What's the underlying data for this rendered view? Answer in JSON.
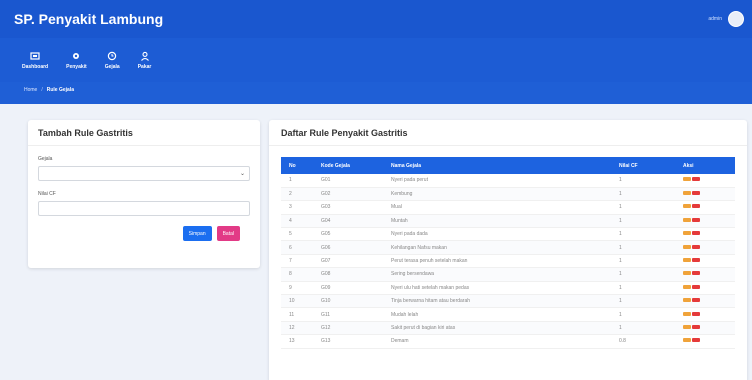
{
  "app": {
    "title": "SP. Penyakit Lambung",
    "user": "admin"
  },
  "nav": [
    {
      "label": "Dashboard",
      "icon": "dashboard-icon"
    },
    {
      "label": "Penyakit",
      "icon": "virus-icon"
    },
    {
      "label": "Gejala",
      "icon": "clock-icon"
    },
    {
      "label": "Pakar",
      "icon": "user-icon"
    }
  ],
  "breadcrumb": {
    "home": "Home",
    "current": "Rule Gejala"
  },
  "form": {
    "title": "Tambah Rule Gastritis",
    "gejala_label": "Gejala",
    "gejala_value": "",
    "nilai_label": "Nilai CF",
    "nilai_value": "",
    "simpan": "Simpan",
    "batal": "Batal"
  },
  "table": {
    "title": "Daftar Rule Penyakit Gastritis",
    "headers": [
      "No",
      "Kode Gejala",
      "Nama Gejala",
      "Nilai CF",
      "Aksi"
    ],
    "rows": [
      [
        "1",
        "G01",
        "Nyeri pada perut",
        "1"
      ],
      [
        "2",
        "G02",
        "Kembung",
        "1"
      ],
      [
        "3",
        "G03",
        "Mual",
        "1"
      ],
      [
        "4",
        "G04",
        "Muntah",
        "1"
      ],
      [
        "5",
        "G05",
        "Nyeri pada dada",
        "1"
      ],
      [
        "6",
        "G06",
        "Kehilangan Nafsu makan",
        "1"
      ],
      [
        "7",
        "G07",
        "Perut terasa penuh setelah makan",
        "1"
      ],
      [
        "8",
        "G08",
        "Sering bersendawa",
        "1"
      ],
      [
        "9",
        "G09",
        "Nyeri ulu hati setelah makan pedas",
        "1"
      ],
      [
        "10",
        "G10",
        "Tinja berwarna hitam atau berdarah",
        "1"
      ],
      [
        "11",
        "G11",
        "Mudah lelah",
        "1"
      ],
      [
        "12",
        "G12",
        "Sakit perut di bagian kiri atas",
        "1"
      ],
      [
        "13",
        "G13",
        "Demam",
        "0.8"
      ]
    ]
  }
}
